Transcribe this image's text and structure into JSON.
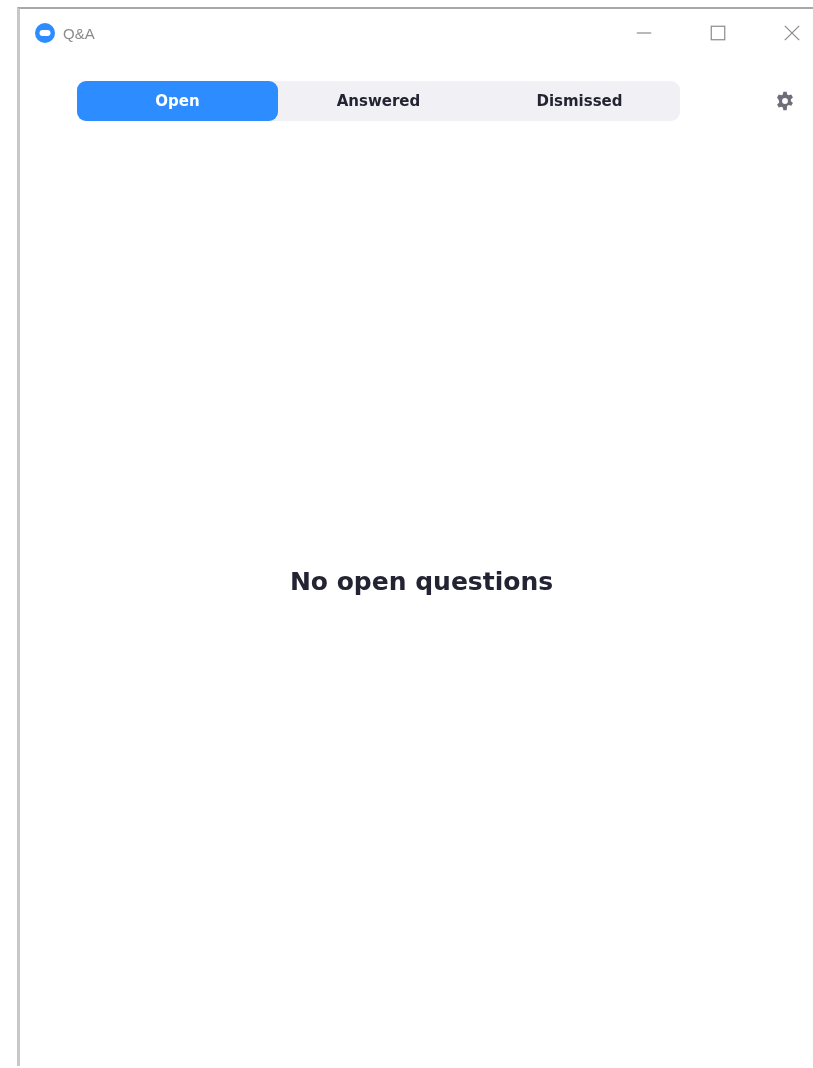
{
  "window": {
    "title": "Q&A"
  },
  "tabs": [
    {
      "label": "Open",
      "selected": true
    },
    {
      "label": "Answered",
      "selected": false
    },
    {
      "label": "Dismissed",
      "selected": false
    }
  ],
  "empty_message": "No open questions"
}
